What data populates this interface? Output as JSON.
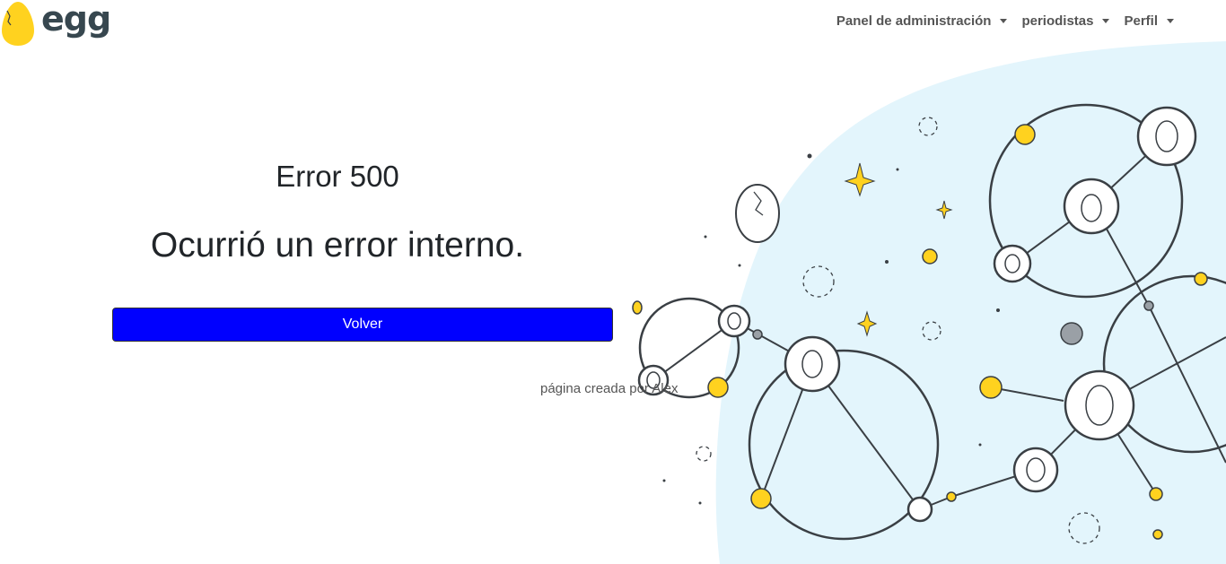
{
  "brand": {
    "name": "egg"
  },
  "nav": {
    "items": [
      {
        "label": "Panel de administración"
      },
      {
        "label": "periodistas"
      },
      {
        "label": "Perfil"
      }
    ]
  },
  "error": {
    "code": "Error 500",
    "message": "Ocurrió un error interno.",
    "back_label": "Volver"
  },
  "footer": {
    "credit": "página creada por Alex"
  },
  "colors": {
    "accent": "#0000ff",
    "egg_yellow": "#ffd21f",
    "bubble_bg": "#e3f5fc",
    "line": "#3a3f44"
  }
}
